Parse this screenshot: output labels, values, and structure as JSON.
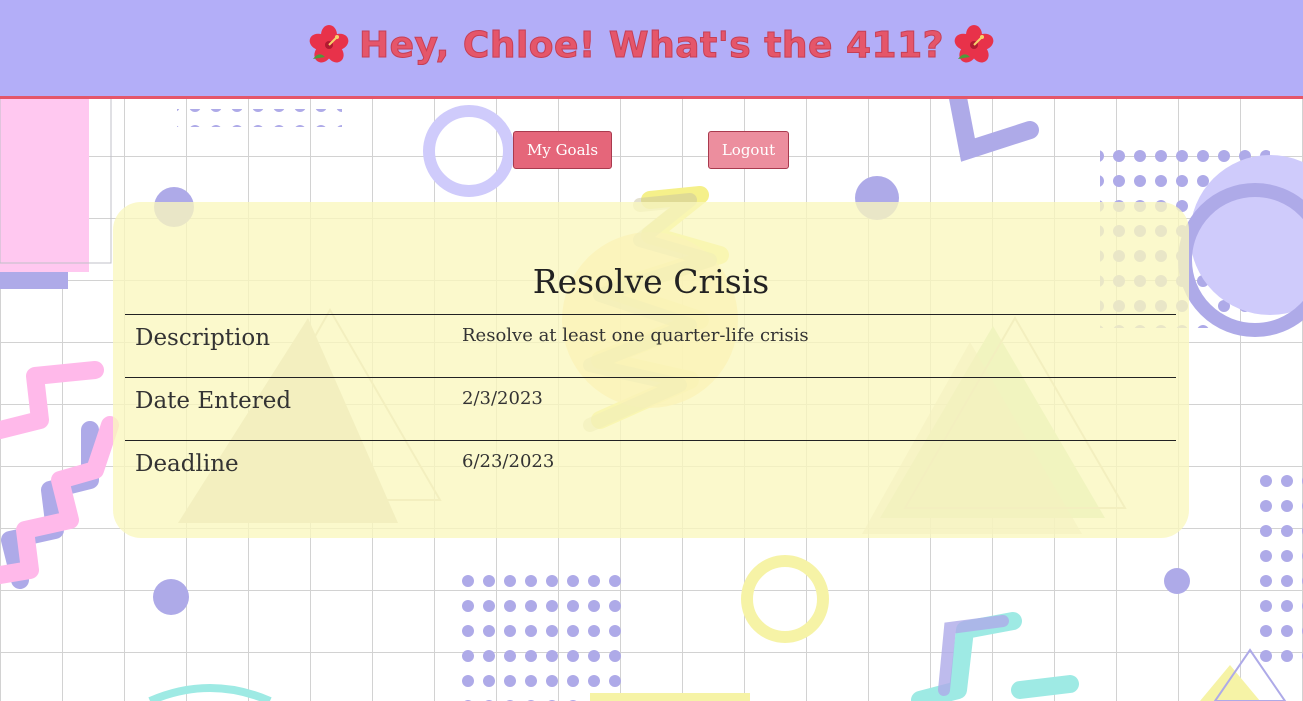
{
  "header": {
    "greeting": "Hey, Chloe! What's the 411?",
    "left_icon": "hibiscus-icon",
    "right_icon": "hibiscus-icon"
  },
  "nav": {
    "goals_label": "My Goals",
    "logout_label": "Logout"
  },
  "goal": {
    "title": "Resolve Crisis",
    "rows": [
      {
        "label": "Description",
        "value": "Resolve at least one quarter-life crisis"
      },
      {
        "label": "Date Entered",
        "value": "2/3/2023"
      },
      {
        "label": "Deadline",
        "value": "6/23/2023"
      }
    ]
  },
  "colors": {
    "header_bg": "#b3aef8",
    "accent_red": "#e5566a",
    "lavender": "#aaa8e6",
    "pink": "#ffc8f0",
    "yellow": "#f6f3a6",
    "teal": "#9eeae4",
    "card_bg": "#faf7be"
  }
}
